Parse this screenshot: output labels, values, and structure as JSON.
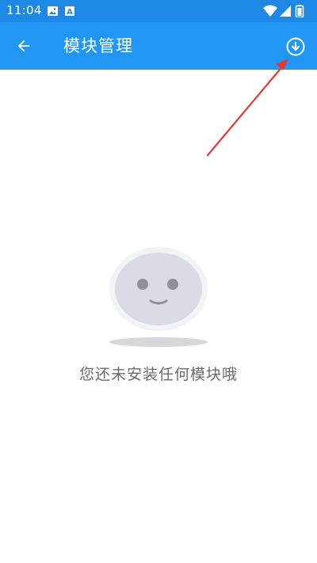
{
  "status_bar": {
    "time": "11:04",
    "left_icons": [
      "image-icon",
      "a-badge-icon"
    ],
    "right_icons": [
      "wifi-icon",
      "signal-icon",
      "battery-icon"
    ]
  },
  "app_bar": {
    "title": "模块管理",
    "back_icon": "arrow-left-icon",
    "action_icon": "download-circle-icon"
  },
  "empty_state": {
    "message": "您还未安装任何模块哦",
    "illustration": "smiley-face-icon"
  },
  "colors": {
    "status_bar": "#1e88e5",
    "app_bar": "#2196f3",
    "annotation_arrow": "#e53935",
    "message_text": "#6b6b6b"
  }
}
